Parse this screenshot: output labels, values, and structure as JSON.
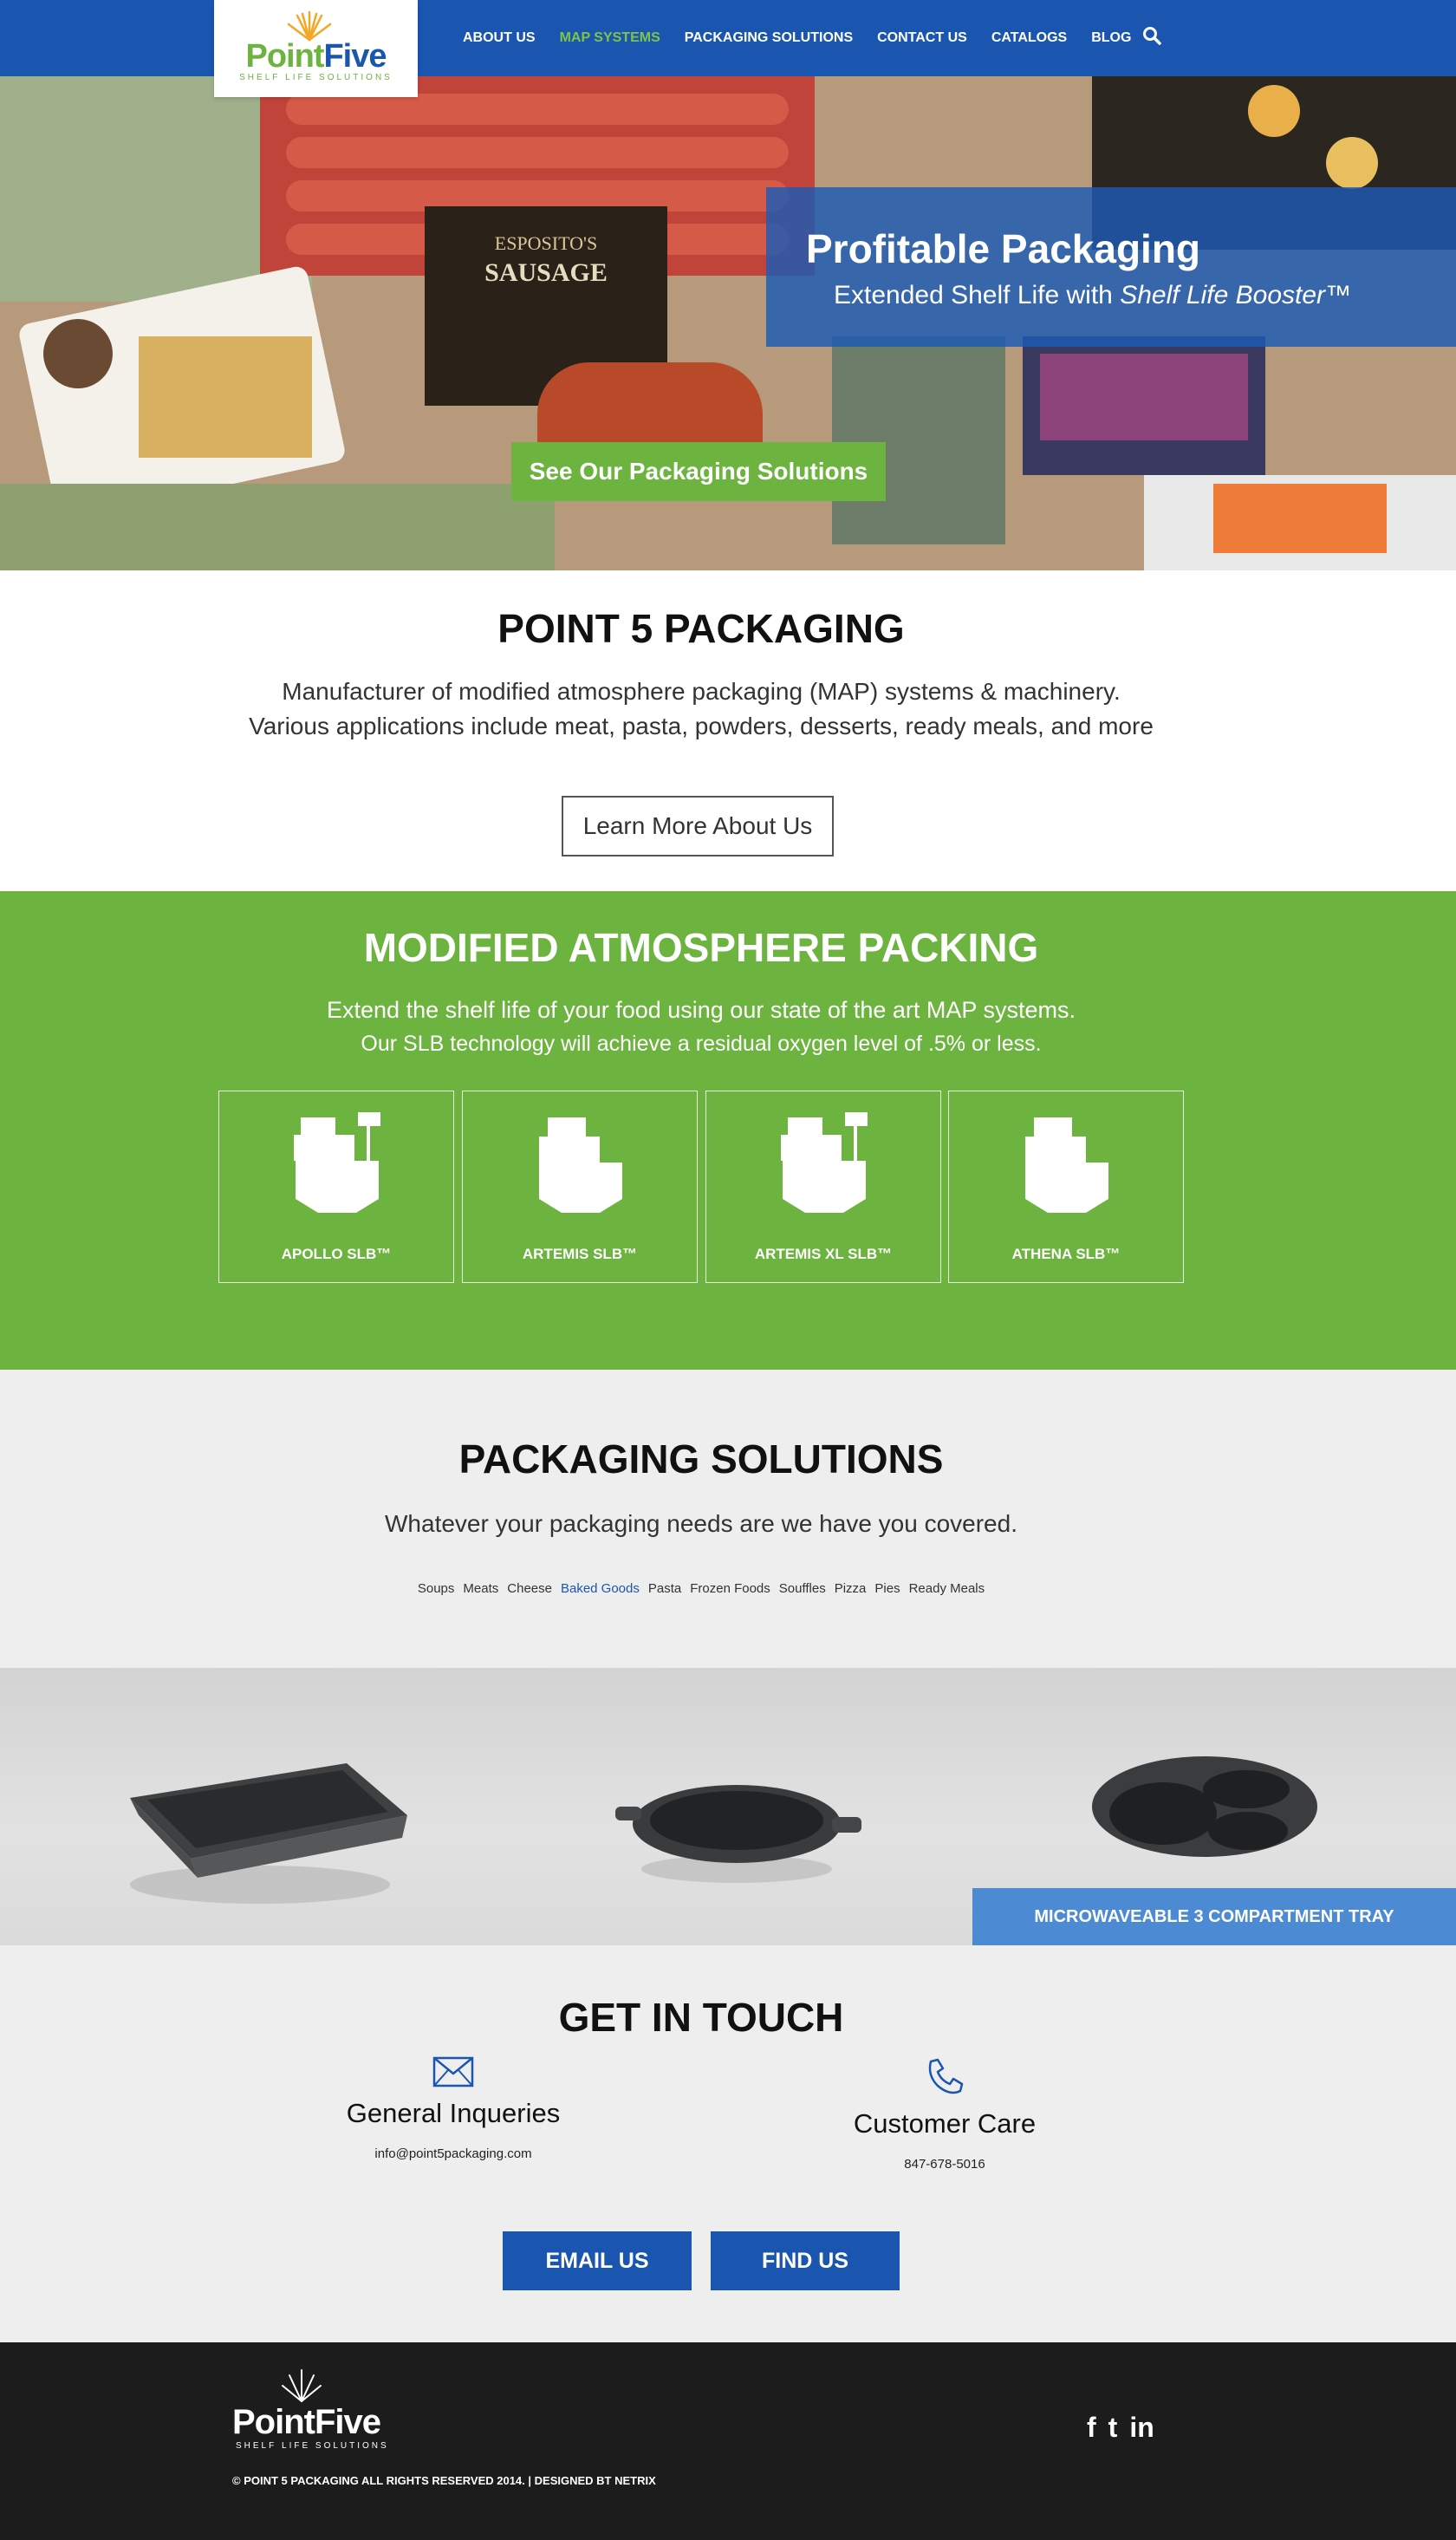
{
  "nav": {
    "logo_primary": "Point",
    "logo_secondary": "Five",
    "logo_tagline": "SHELF LIFE SOLUTIONS",
    "items": [
      {
        "label": "ABOUT US"
      },
      {
        "label": "MAP SYSTEMS"
      },
      {
        "label": "PACKAGING SOLUTIONS"
      },
      {
        "label": "CONTACT US"
      },
      {
        "label": "CATALOGS"
      },
      {
        "label": "BLOG"
      }
    ],
    "search_icon": "search-icon"
  },
  "hero": {
    "title": "Profitable Packaging",
    "subtitle_prefix": "Extended Shelf Life with",
    "subtitle_brand": "Shelf Life Booster™",
    "cta": "See Our Packaging Solutions"
  },
  "about": {
    "title": "POINT 5 PACKAGING",
    "line1": "Manufacturer of modified atmosphere packaging (MAP) systems & machinery.",
    "line2": "Various applications include meat, pasta, powders, desserts, ready meals, and more",
    "button": "Learn More About Us"
  },
  "map": {
    "title": "MODIFIED ATMOSPHERE PACKING",
    "line1": "Extend the shelf life of your food using our state of the art MAP systems.",
    "line2": "Our SLB technology will achieve a residual oxygen level of .5% or less.",
    "machines": [
      {
        "label": "APOLLO SLB™"
      },
      {
        "label": "ARTEMIS SLB™"
      },
      {
        "label": "ARTEMIS XL SLB™"
      },
      {
        "label": "ATHENA SLB™"
      }
    ]
  },
  "packaging": {
    "title": "PACKAGING SOLUTIONS",
    "subtitle": "Whatever your packaging needs are we have you covered.",
    "filters": [
      "Soups",
      "Meats",
      "Cheese",
      "Baked Goods",
      "Pasta",
      "Frozen Foods",
      "Souffles",
      "Pizza",
      "Pies",
      "Ready Meals"
    ],
    "active_filter": "Baked Goods",
    "caption": "MICROWAVEABLE 3 COMPARTMENT TRAY"
  },
  "contact": {
    "title": "GET IN TOUCH",
    "general_title": "General Inqueries",
    "general_value": "info@point5packaging.com",
    "care_title": "Customer Care",
    "care_value": "847-678-5016",
    "email_button": "EMAIL US",
    "find_button": "FIND US"
  },
  "footer": {
    "logo_text": "PointFive",
    "logo_tagline": "SHELF LIFE SOLUTIONS",
    "copyright": "© POINT 5 PACKAGING ALL RIGHTS RESERVED 2014. | DESIGNED BT NETRIX",
    "social": [
      "f",
      "t",
      "in"
    ]
  },
  "colors": {
    "nav_blue": "#1a56b0",
    "green": "#6cb33f",
    "footer": "#1d1c1d"
  }
}
